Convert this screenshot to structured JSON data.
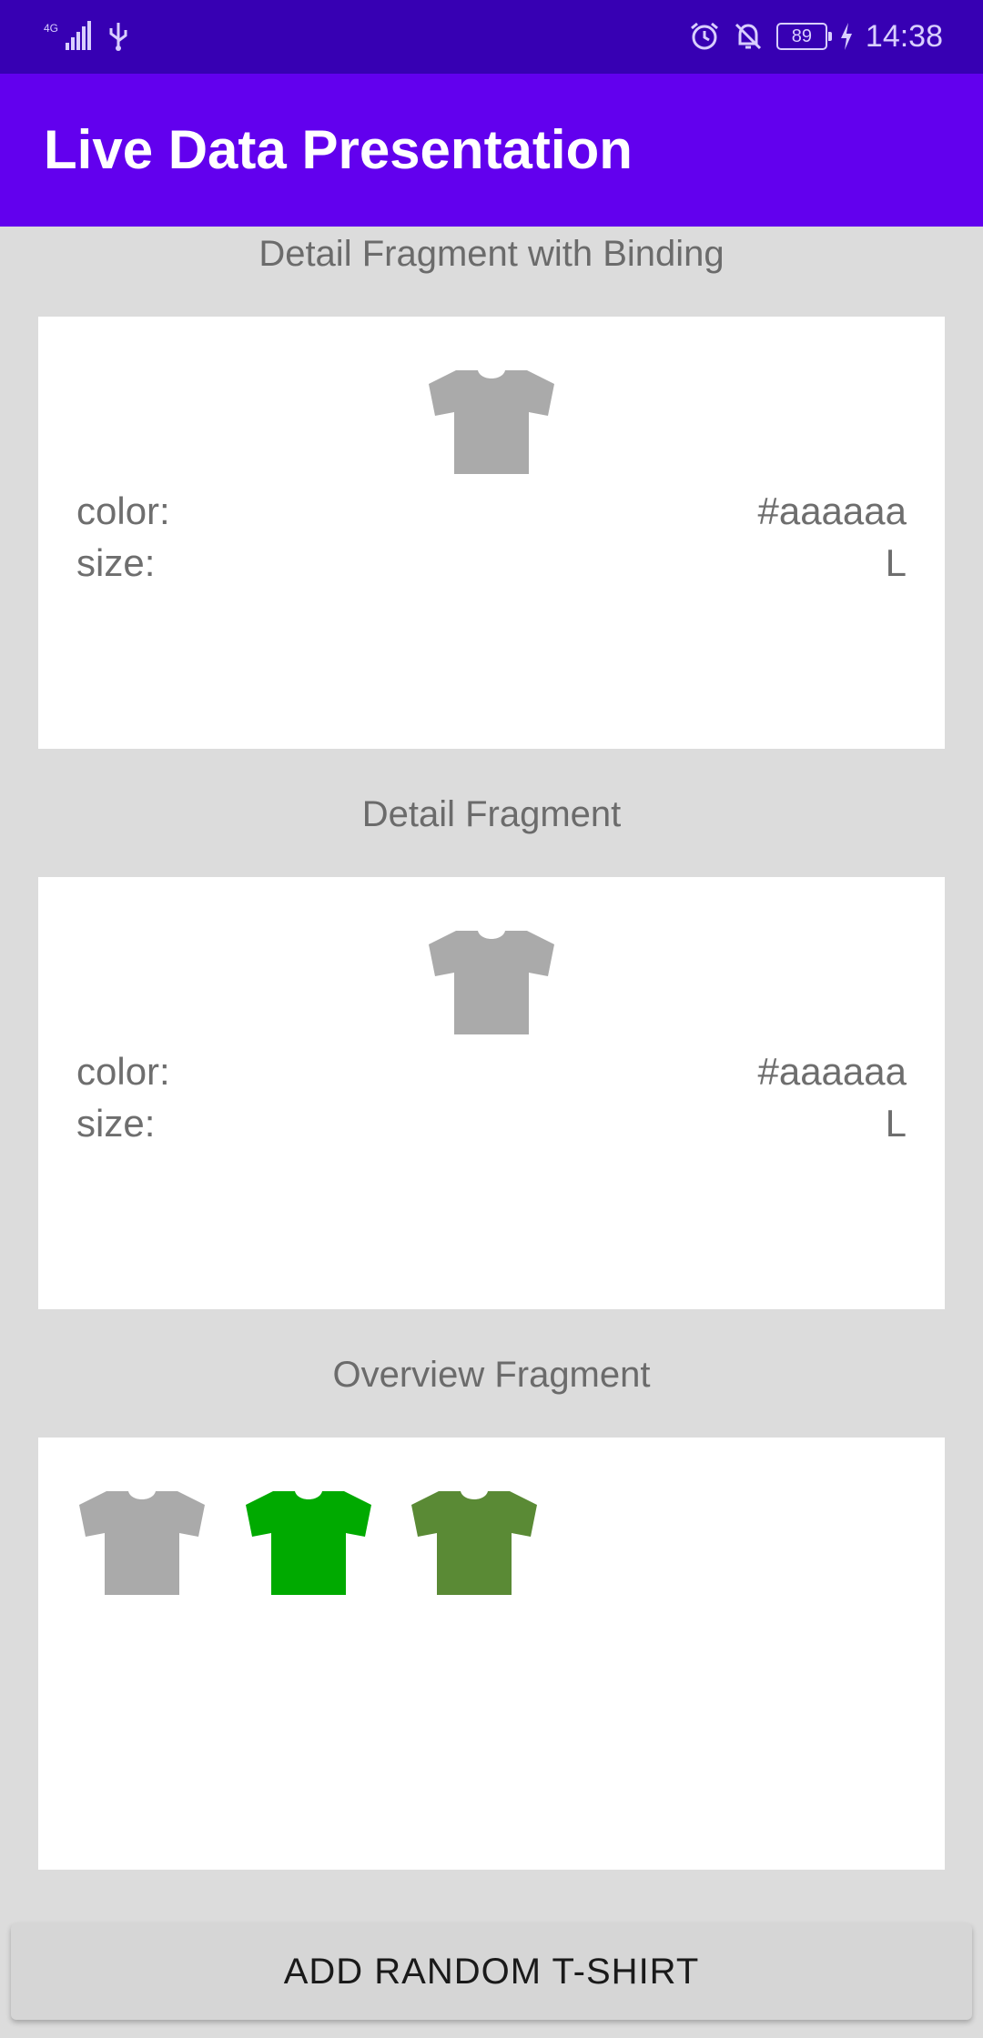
{
  "status_bar": {
    "network": "4G",
    "battery": "89",
    "time": "14:38"
  },
  "app_bar": {
    "title": "Live Data Presentation"
  },
  "detail_binding": {
    "title": "Detail Fragment with Binding",
    "color_label": "color:",
    "color_value": "#aaaaaa",
    "size_label": "size:",
    "size_value": "L"
  },
  "detail": {
    "title": "Detail Fragment",
    "color_label": "color:",
    "color_value": "#aaaaaa",
    "size_label": "size:",
    "size_value": "L"
  },
  "overview": {
    "title": "Overview Fragment",
    "shirts": [
      {
        "color": "#aaaaaa",
        "icon": "tshirt-icon"
      },
      {
        "color": "#00aa00",
        "icon": "tshirt-icon"
      },
      {
        "color": "#5a8a35",
        "icon": "tshirt-icon"
      }
    ]
  },
  "actions": {
    "add_random_label": "ADD RANDOM T-SHIRT"
  },
  "colors": {
    "status_bar": "#3700b3",
    "app_bar": "#6200ee",
    "background": "#dcdcdc",
    "card": "#ffffff",
    "button": "#d6d6d6"
  }
}
